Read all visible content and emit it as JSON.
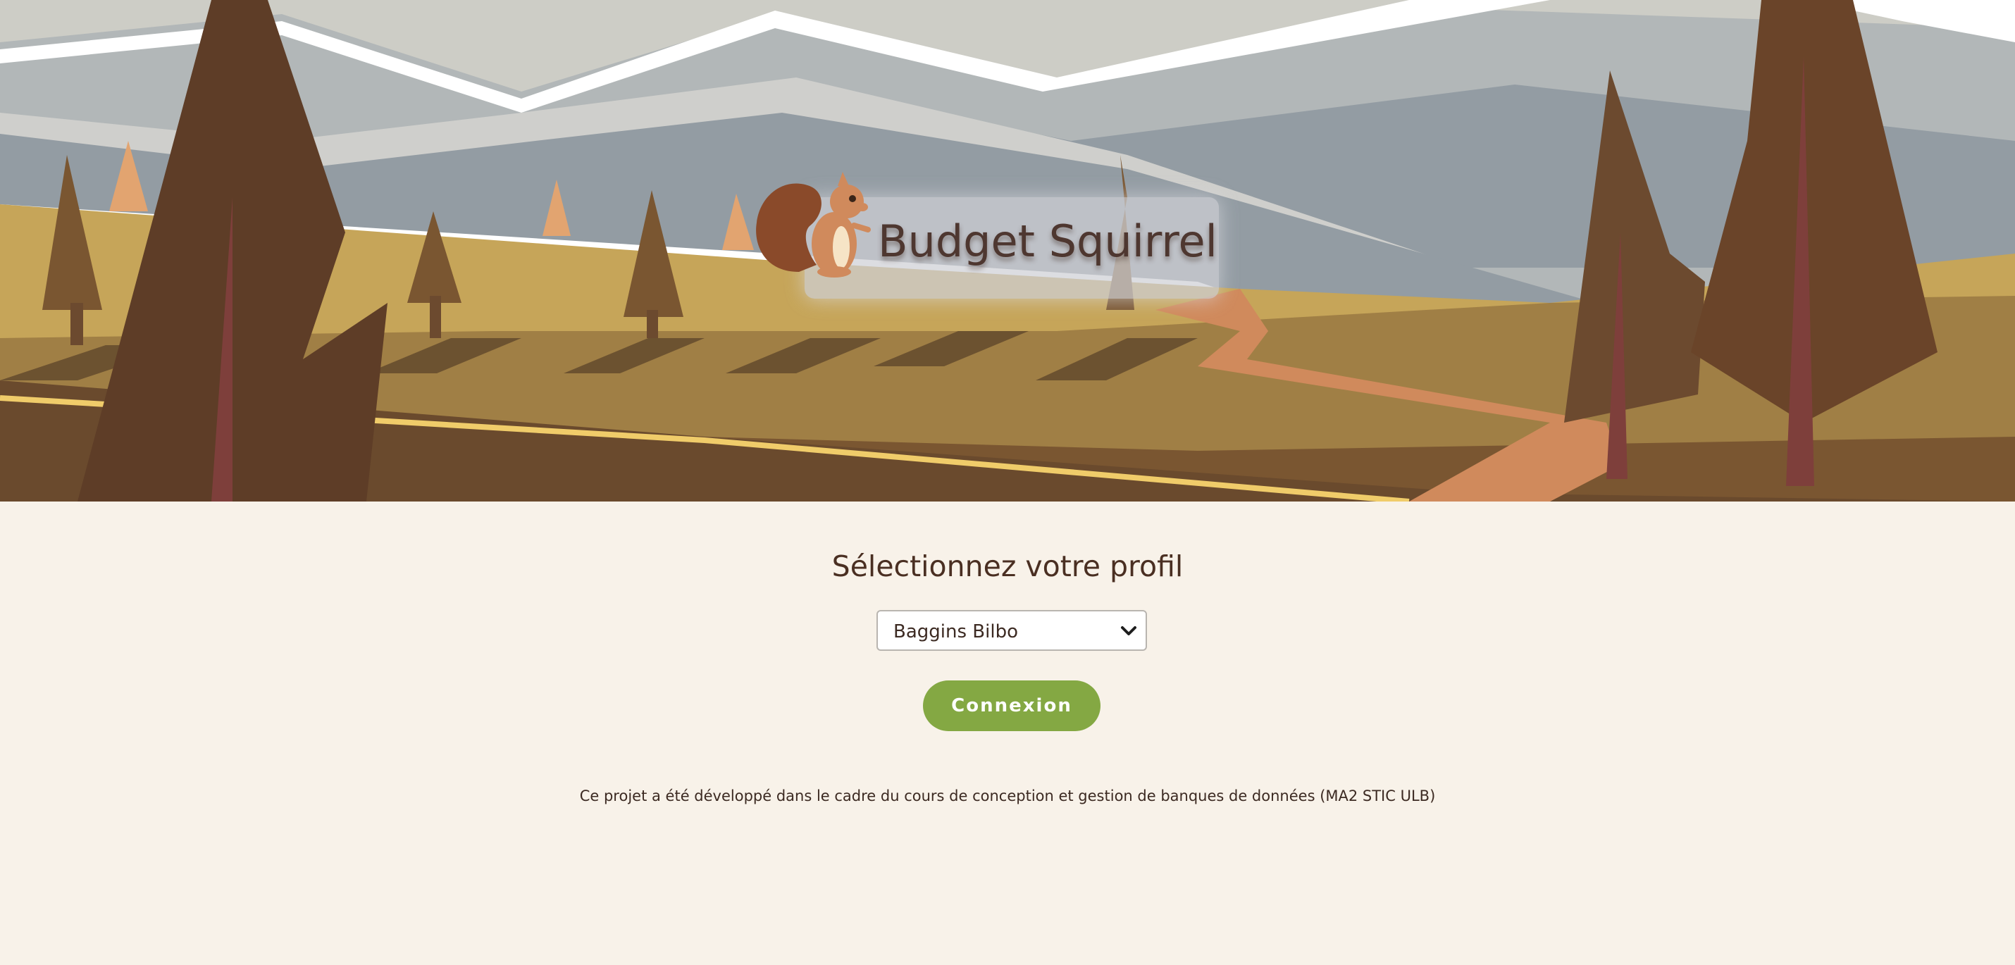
{
  "app": {
    "title": "Budget Squirrel"
  },
  "login": {
    "heading": "Sélectionnez votre profil",
    "profile_select": {
      "selected": "Baggins Bilbo"
    },
    "connect_label": "Connexion"
  },
  "footer": {
    "text": "Ce projet a été développé dans le cadre du cours de conception et gestion de banques de données (MA2 STIC ULB)"
  },
  "colors": {
    "background": "#f8f2e9",
    "primary_button": "#84a843",
    "text": "#4a2f22"
  },
  "icons": {
    "logo": "squirrel-icon",
    "select": "chevron-down-icon"
  }
}
